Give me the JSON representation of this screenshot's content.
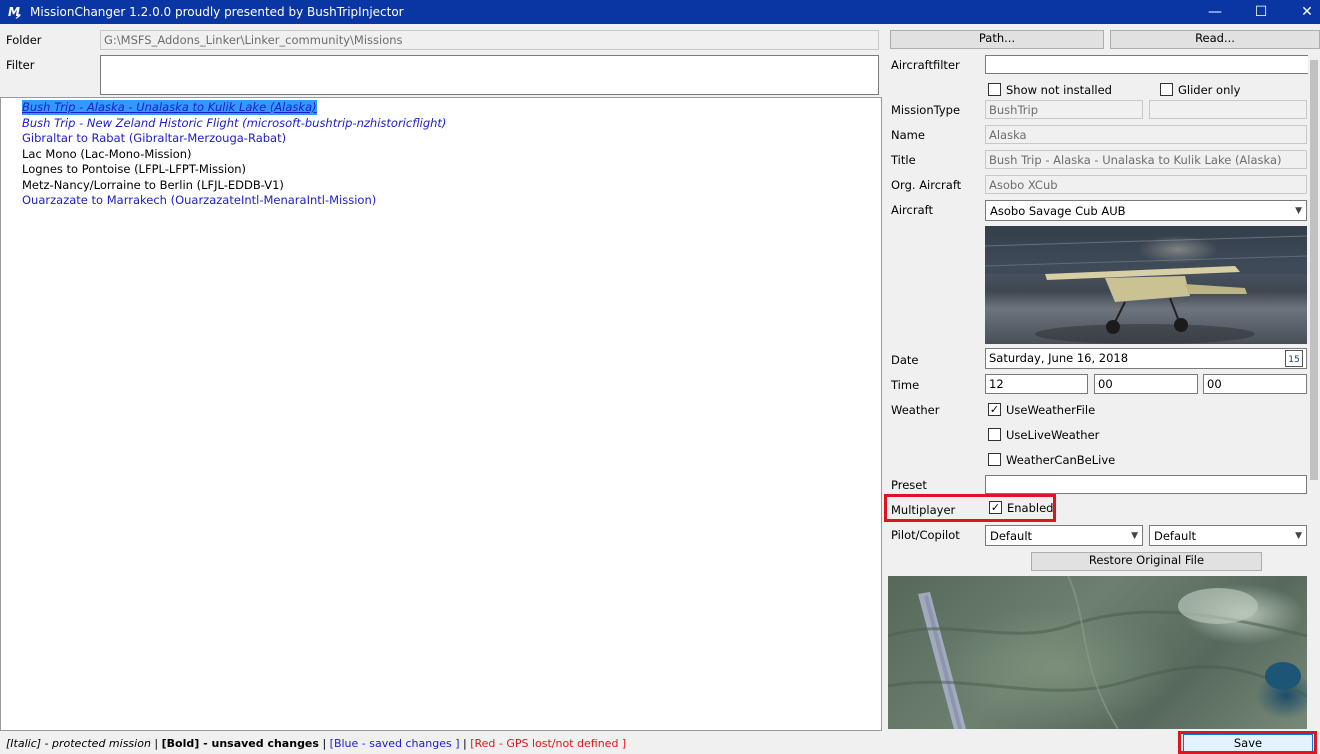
{
  "window": {
    "title": "MissionChanger 1.2.0.0 proudly presented by BushTripInjector",
    "icon": "app-icon",
    "controls": {
      "minimize": "—",
      "maximize": "☐",
      "close": "✕"
    }
  },
  "folder": {
    "label": "Folder",
    "value": "G:\\MSFS_Addons_Linker\\Linker_community\\Missions"
  },
  "filter": {
    "label": "Filter",
    "value": ""
  },
  "buttons": {
    "path": "Path...",
    "read": "Read...",
    "restore": "Restore Original File",
    "save": "Save"
  },
  "missions": [
    {
      "text": "Bush Trip - Alaska - Unalaska to Kulik Lake (Alaska)",
      "style": "italic-blue",
      "selected": true
    },
    {
      "text": "Bush Trip - New Zeland Historic Flight (microsoft-bushtrip-nzhistoricflight)",
      "style": "italic-blue",
      "selected": false
    },
    {
      "text": "Gibraltar to Rabat (Gibraltar-Merzouga-Rabat)",
      "style": "blue",
      "selected": false
    },
    {
      "text": "Lac Mono (Lac-Mono-Mission)",
      "style": "normal",
      "selected": false
    },
    {
      "text": "Lognes to Pontoise (LFPL-LFPT-Mission)",
      "style": "normal",
      "selected": false
    },
    {
      "text": "Metz-Nancy/Lorraine to Berlin (LFJL-EDDB-V1)",
      "style": "normal",
      "selected": false
    },
    {
      "text": "Ouarzazate to Marrakech (OuarzazateIntl-MenaraIntl-Mission)",
      "style": "blue",
      "selected": false
    }
  ],
  "details": {
    "aircraftfilter": {
      "label": "Aircraftfilter",
      "value": ""
    },
    "show_not_installed": {
      "label": "Show not installed",
      "checked": false
    },
    "glider_only": {
      "label": "Glider only",
      "checked": false
    },
    "mission_type": {
      "label": "MissionType",
      "value": "BushTrip",
      "value2": ""
    },
    "name": {
      "label": "Name",
      "value": "Alaska"
    },
    "title": {
      "label": "Title",
      "value": "Bush Trip - Alaska - Unalaska to Kulik Lake (Alaska)"
    },
    "org_aircraft": {
      "label": "Org. Aircraft",
      "value": "Asobo XCub"
    },
    "aircraft": {
      "label": "Aircraft",
      "value": "Asobo Savage Cub AUB"
    },
    "date": {
      "label": "Date",
      "value": "Saturday, June 16, 2018",
      "calendar_day": "15"
    },
    "time": {
      "label": "Time",
      "hour": "12",
      "minute": "00",
      "second": "00"
    },
    "weather": {
      "label": "Weather",
      "use_weather_file": {
        "label": "UseWeatherFile",
        "checked": true
      },
      "use_live_weather": {
        "label": "UseLiveWeather",
        "checked": false
      },
      "weather_can_be_live": {
        "label": "WeatherCanBeLive",
        "checked": false
      }
    },
    "preset": {
      "label": "Preset",
      "value": ""
    },
    "multiplayer": {
      "label": "Multiplayer",
      "enabled_label": "Enabled",
      "checked": true
    },
    "pilot_copilot": {
      "label": "Pilot/Copilot",
      "pilot": "Default",
      "copilot": "Default"
    }
  },
  "statusbar": {
    "italic_tag": "[Italic]",
    "italic_desc": " - protected mission | ",
    "bold_tag": "[Bold] - unsaved changes",
    "sep1": " | ",
    "blue_part": "[Blue - saved changes ]",
    "sep2": " | ",
    "red_part": "[Red - GPS lost/not defined ]"
  },
  "colors": {
    "titlebar": "#0a36a4",
    "blue_text": "#1c1cc8",
    "red_text": "#e0141e",
    "selection": "#3399ff",
    "highlight_box": "#e0141e"
  }
}
